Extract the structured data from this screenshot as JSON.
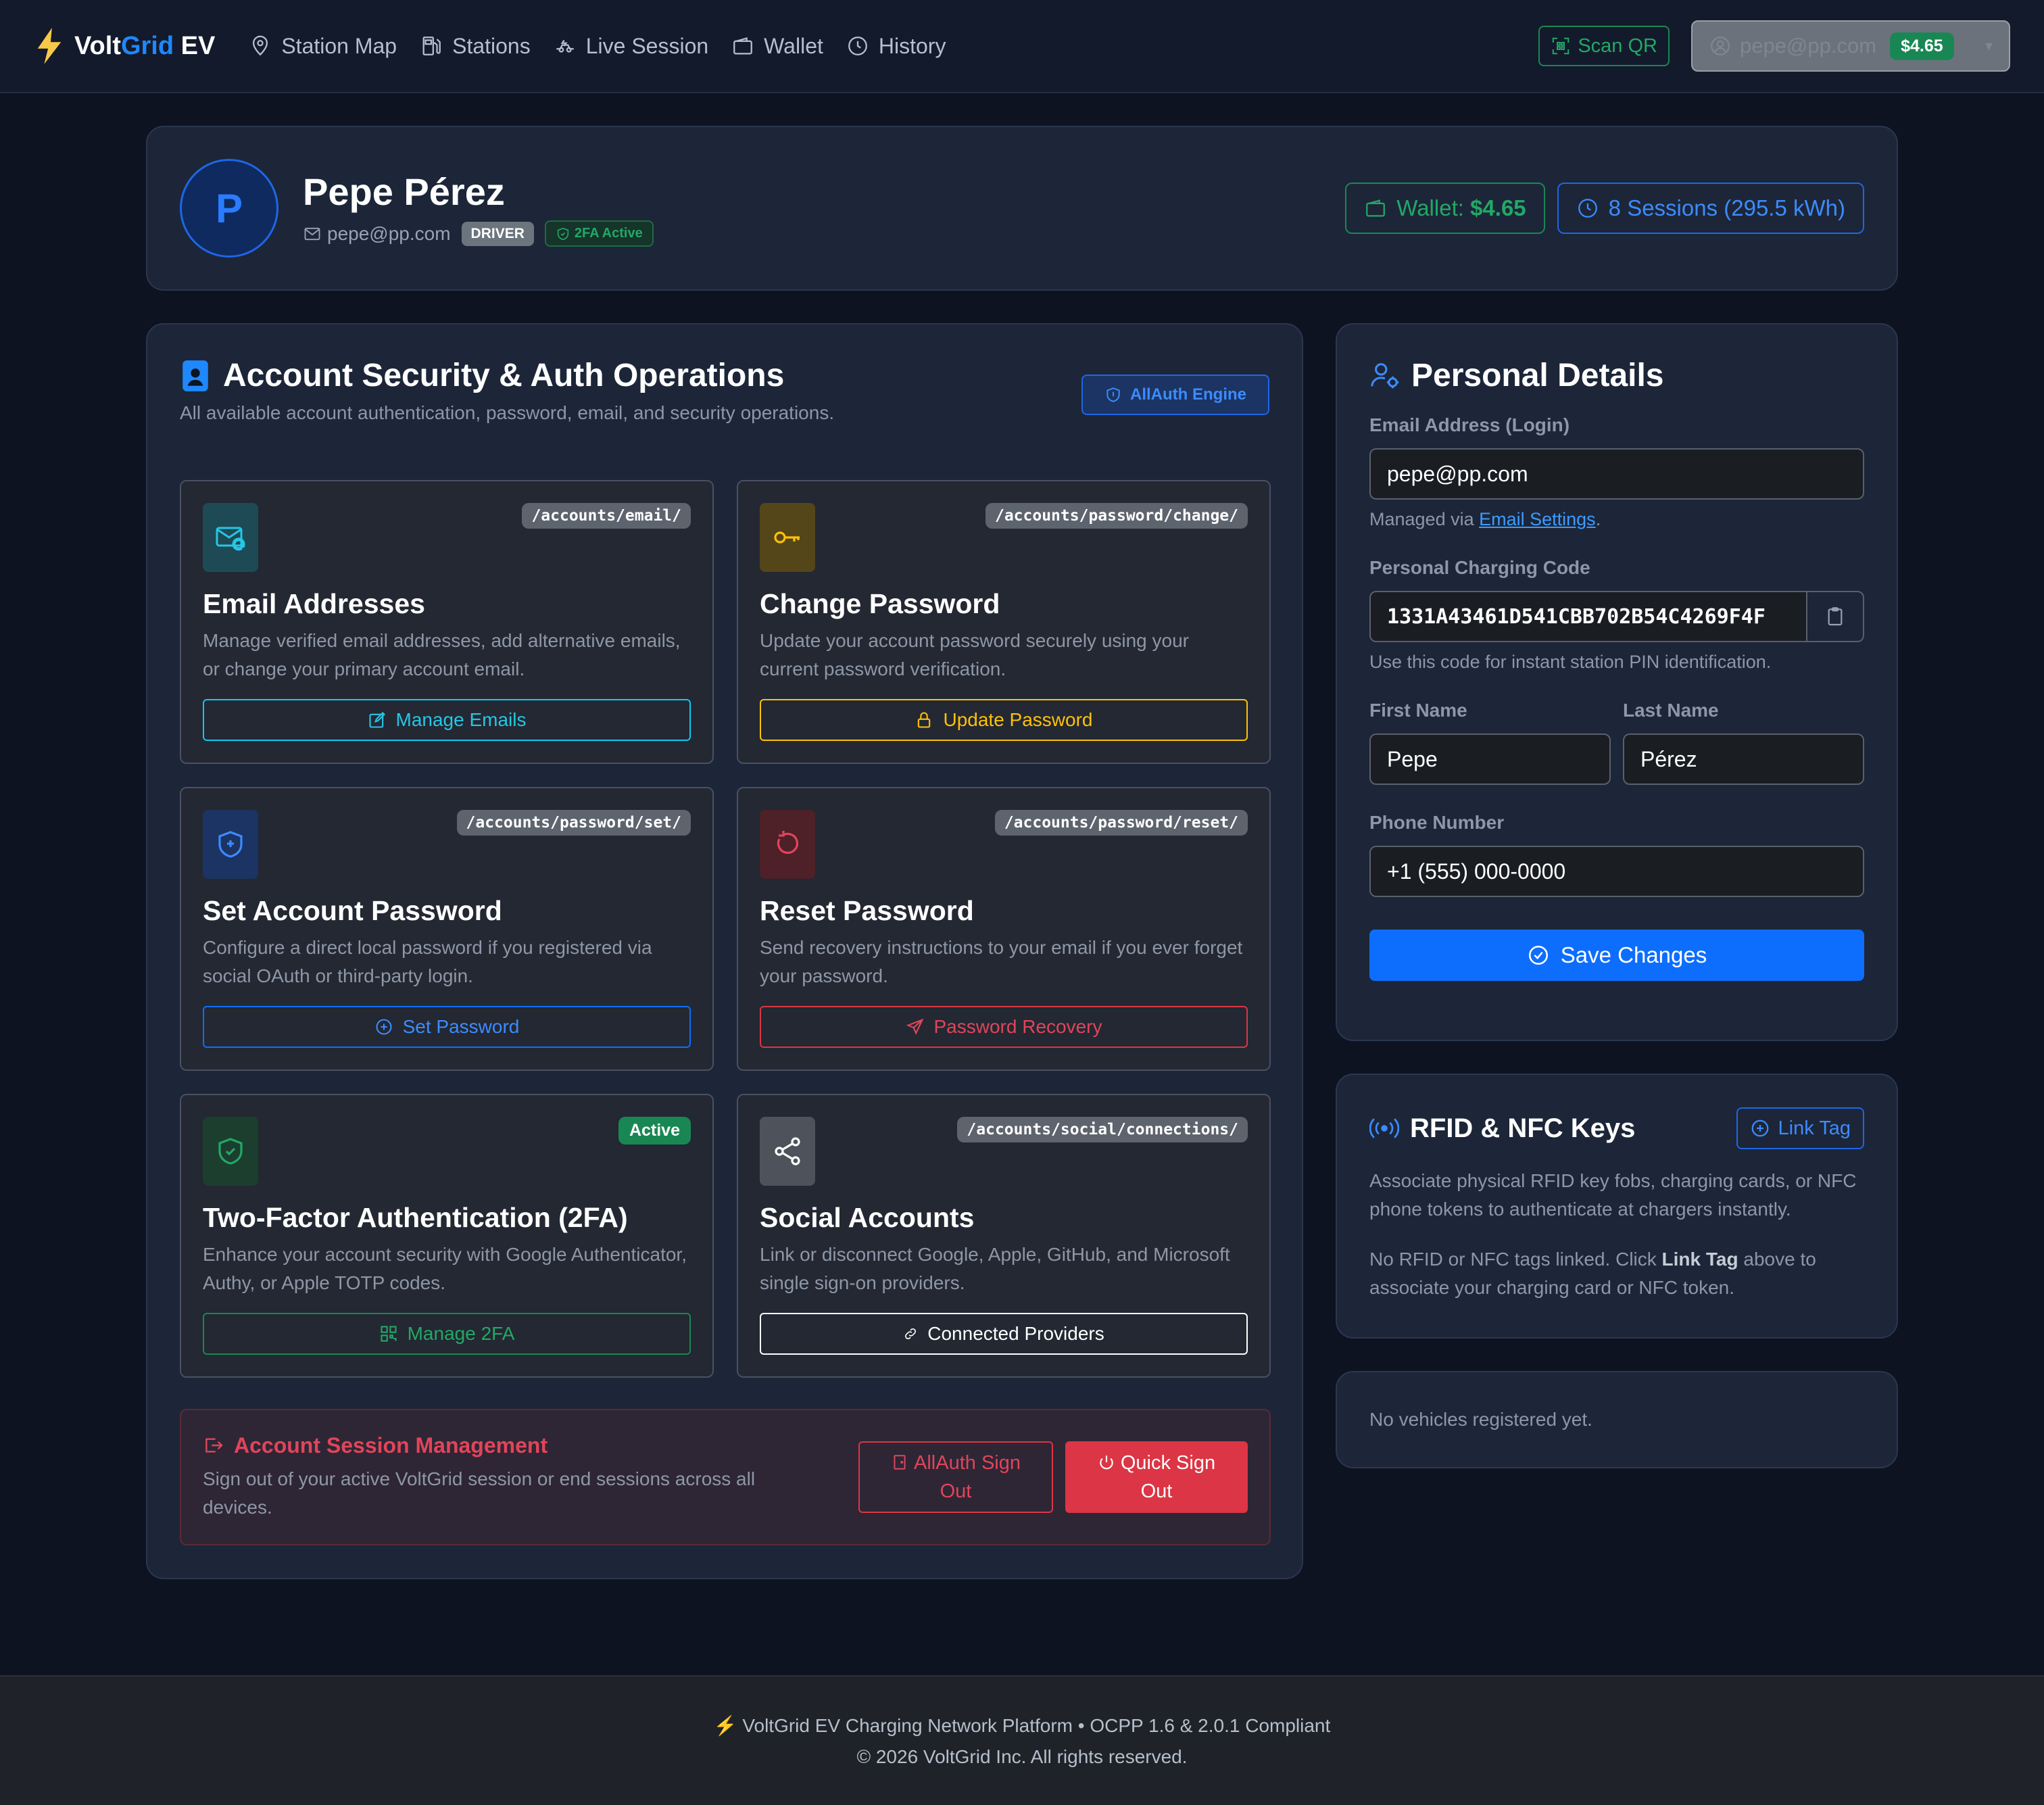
{
  "nav": {
    "brand_part1": "Volt",
    "brand_part2": "Grid",
    "brand_part3": " EV",
    "links": [
      {
        "label": "Station Map",
        "icon": "map-pin-icon"
      },
      {
        "label": "Stations",
        "icon": "fuel-pump-icon"
      },
      {
        "label": "Live Session",
        "icon": "ev-plug-icon"
      },
      {
        "label": "Wallet",
        "icon": "wallet-icon"
      },
      {
        "label": "History",
        "icon": "clock-icon"
      }
    ],
    "scan_label": "Scan QR",
    "user_email": "pepe@pp.com",
    "user_balance": "$4.65"
  },
  "profile": {
    "initial": "P",
    "name": "Pepe Pérez",
    "email": "pepe@pp.com",
    "role_badge": "DRIVER",
    "twofa_badge": "2FA Active",
    "wallet_label": "Wallet: ",
    "wallet_value": "$4.65",
    "sessions_label": "8 Sessions (295.5 kWh)"
  },
  "security": {
    "title": "Account Security & Auth Operations",
    "subtitle": "All available account authentication, password, email, and security operations.",
    "engine_badge": "AllAuth Engine",
    "tiles": [
      {
        "route": "/accounts/email/",
        "title": "Email Addresses",
        "desc": "Manage verified email addresses, add alternative emails, or change your primary account email.",
        "button": "Manage Emails"
      },
      {
        "route": "/accounts/password/change/",
        "title": "Change Password",
        "desc": "Update your account password securely using your current password verification.",
        "button": "Update Password"
      },
      {
        "route": "/accounts/password/set/",
        "title": "Set Account Password",
        "desc": "Configure a direct local password if you registered via social OAuth or third-party login.",
        "button": "Set Password"
      },
      {
        "route": "/accounts/password/reset/",
        "title": "Reset Password",
        "desc": "Send recovery instructions to your email if you ever forget your password.",
        "button": "Password Recovery"
      },
      {
        "route": "Active",
        "title": "Two-Factor Authentication (2FA)",
        "desc": "Enhance your account security with Google Authenticator, Authy, or Apple TOTP codes.",
        "button": "Manage 2FA"
      },
      {
        "route": "/accounts/social/connections/",
        "title": "Social Accounts",
        "desc": "Link or disconnect Google, Apple, GitHub, and Microsoft single sign-on providers.",
        "button": "Connected Providers"
      }
    ],
    "session": {
      "title": "Account Session Management",
      "desc": "Sign out of your active VoltGrid session or end sessions across all devices.",
      "allauth_signout": "AllAuth Sign Out",
      "quick_signout": "Quick Sign Out"
    }
  },
  "details": {
    "title": "Personal Details",
    "email_label": "Email Address (Login)",
    "email_value": "pepe@pp.com",
    "managed_prefix": "Managed via ",
    "managed_link": "Email Settings",
    "managed_suffix": ".",
    "code_label": "Personal Charging Code",
    "code_value": "1331A43461D541CBB702B54C4269F4F",
    "code_help": "Use this code for instant station PIN identification.",
    "first_label": "First Name",
    "first_value": "Pepe",
    "last_label": "Last Name",
    "last_value": "Pérez",
    "phone_label": "Phone Number",
    "phone_placeholder": "+1 (555) 000-0000",
    "save_label": "Save Changes"
  },
  "rfid": {
    "title": "RFID & NFC Keys",
    "link_label": "Link Tag",
    "desc": "Associate physical RFID key fobs, charging cards, or NFC phone tokens to authenticate at chargers instantly.",
    "empty_prefix": "No RFID or NFC tags linked. Click ",
    "empty_bold": "Link Tag",
    "empty_suffix": " above to associate your charging card or NFC token."
  },
  "vehicles": {
    "empty": "No vehicles registered yet."
  },
  "footer": {
    "line1": "VoltGrid EV Charging Network Platform • OCPP 1.6 & 2.0.1 Compliant",
    "line2": "© 2026 VoltGrid Inc. All rights reserved."
  },
  "colors": {
    "accent_blue": "#0d6efd",
    "success_green": "#198754",
    "danger_red": "#dc3545",
    "warning_yellow": "#ffc107",
    "info_cyan": "#0dcaf0"
  }
}
